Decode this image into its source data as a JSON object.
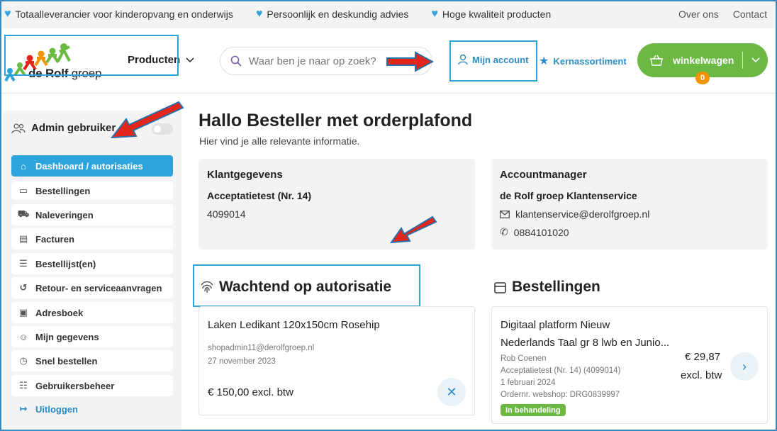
{
  "topbar": {
    "usps": [
      "Totaalleverancier voor kinderopvang en onderwijs",
      "Persoonlijk en deskundig advies",
      "Hoge kwaliteit producten"
    ],
    "links": [
      "Over ons",
      "Contact"
    ]
  },
  "header": {
    "logo_text_main": "de Rolf",
    "logo_text_sub": "groep",
    "products_label": "Producten",
    "search_placeholder": "Waar ben je naar op zoek?",
    "account_label": "Mijn account",
    "kern_label": "Kernassortiment",
    "cart_label": "winkelwagen",
    "cart_count": "0"
  },
  "sidebar": {
    "admin_label": "Admin gebruiker",
    "items": [
      {
        "label": "Dashboard / autorisaties",
        "icon": "home-icon"
      },
      {
        "label": "Bestellingen",
        "icon": "calendar-icon"
      },
      {
        "label": "Naleveringen",
        "icon": "truck-icon"
      },
      {
        "label": "Facturen",
        "icon": "invoice-icon"
      },
      {
        "label": "Bestellijst(en)",
        "icon": "list-icon"
      },
      {
        "label": "Retour- en serviceaanvragen",
        "icon": "return-icon"
      },
      {
        "label": "Adresboek",
        "icon": "addressbook-icon"
      },
      {
        "label": "Mijn gegevens",
        "icon": "user-icon"
      },
      {
        "label": "Snel bestellen",
        "icon": "stopwatch-icon"
      },
      {
        "label": "Gebruikersbeheer",
        "icon": "users-icon"
      }
    ],
    "logout_label": "Uitloggen"
  },
  "main": {
    "title": "Hallo Besteller met orderplafond",
    "subtitle": "Hier vind je alle relevante informatie.",
    "klant": {
      "heading": "Klantgegevens",
      "name": "Acceptatietest (Nr. 14)",
      "number": "4099014"
    },
    "accountmanager": {
      "heading": "Accountmanager",
      "name": "de Rolf groep Klantenservice",
      "email": "klantenservice@derolfgroep.nl",
      "phone": "0884101020"
    },
    "wachtend": {
      "heading": "Wachtend op autorisatie",
      "product": "Laken Ledikant 120x150cm Rosehip",
      "email": "shopadmin11@derolfgroep.nl",
      "date": "27 november 2023",
      "price": "€ 150,00 excl. btw"
    },
    "bestellingen": {
      "heading": "Bestellingen",
      "line1": "Digitaal platform Nieuw",
      "line2": "Nederlands Taal gr 8 lwb en Junio...",
      "person": "Rob Coenen",
      "company": "Acceptatietest (Nr. 14) (4099014)",
      "date": "1 februari 2024",
      "order": "Ordernr. webshop: DRG0839997",
      "price": "€ 29,87",
      "price_note": "excl. btw",
      "status": "In behandeling"
    }
  },
  "colors": {
    "accent": "#2fa3dc",
    "link": "#2b8cc4",
    "cart": "#6bb843",
    "badge": "#f29400",
    "arrow": "#e3261b"
  }
}
